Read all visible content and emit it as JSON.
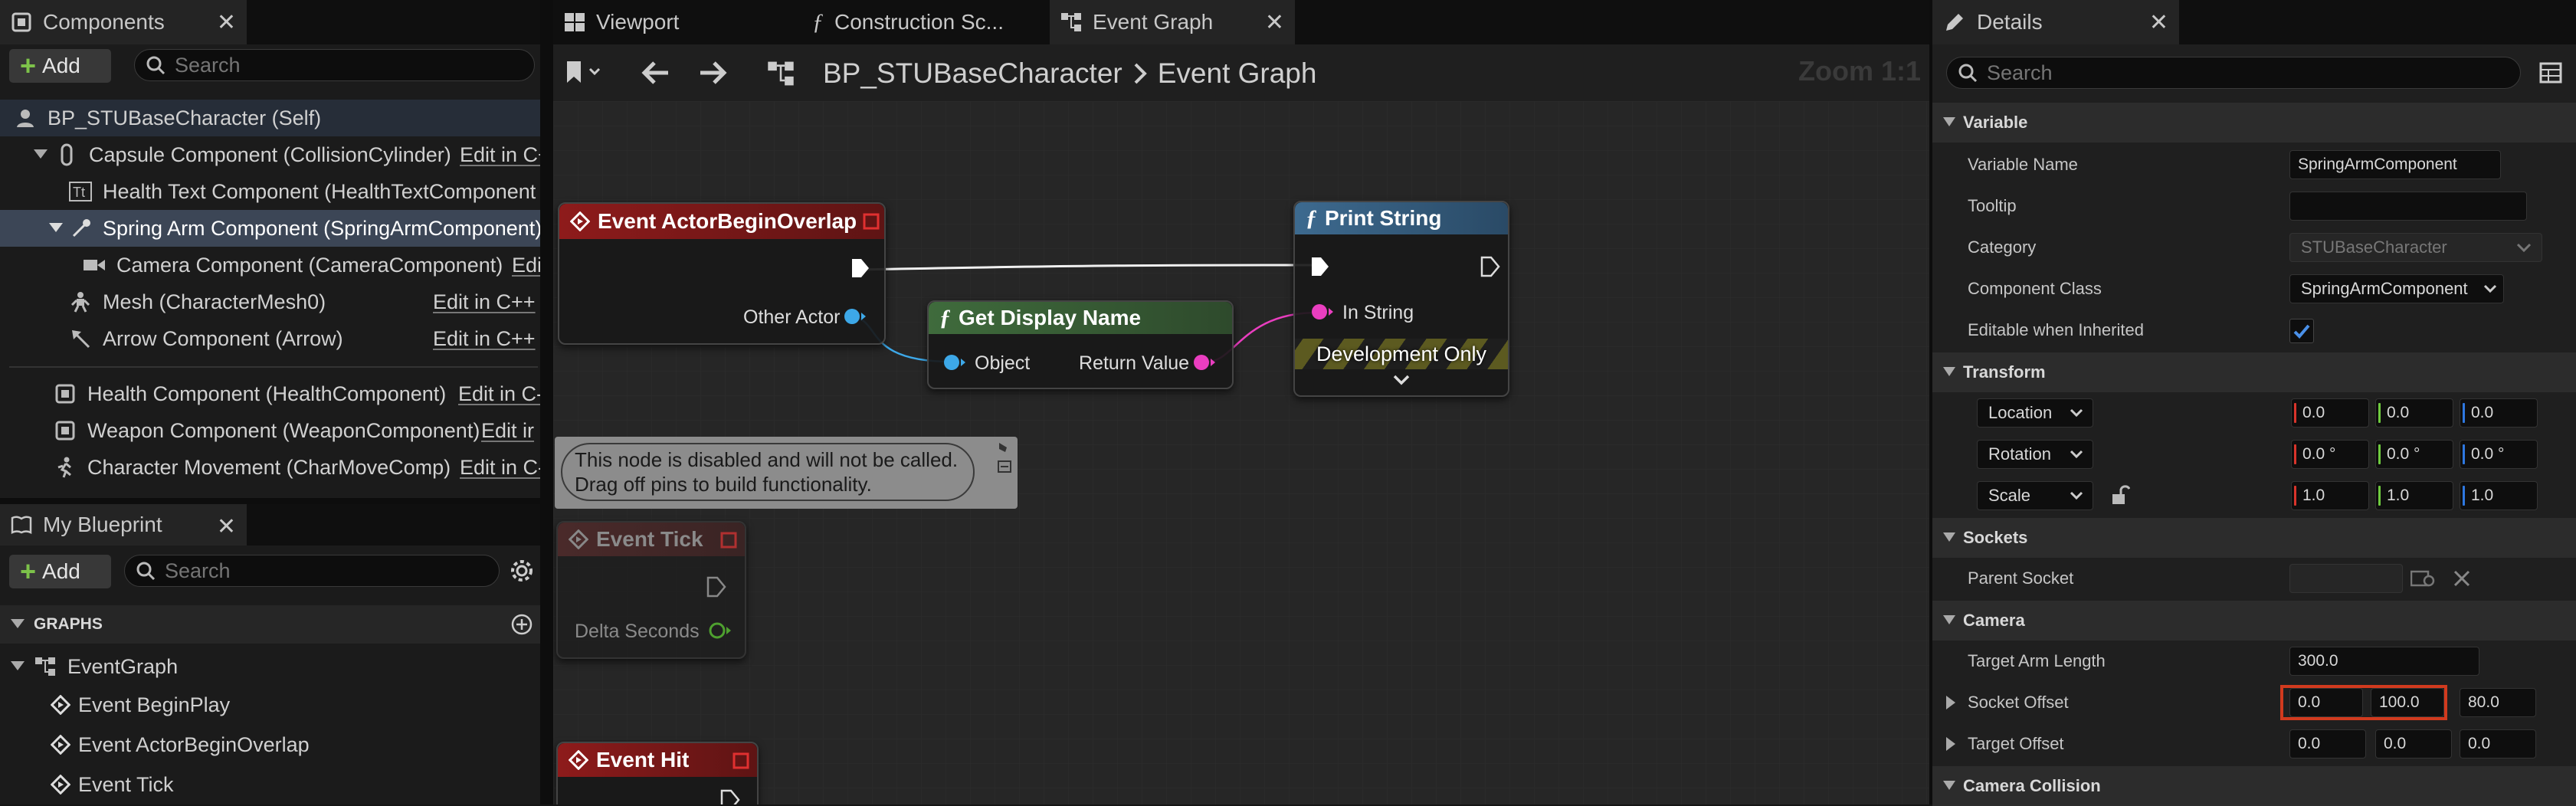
{
  "components": {
    "tab_label": "Components",
    "add_label": "Add",
    "search_placeholder": "Search",
    "tree": [
      {
        "label": "BP_STUBaseCharacter (Self)",
        "edit": ""
      },
      {
        "label": "Capsule Component (CollisionCylinder)",
        "edit": "Edit in C+"
      },
      {
        "label": "Health Text Component (HealthTextComponent",
        "edit": ""
      },
      {
        "label": "Spring Arm Component (SpringArmComponent)",
        "edit": ""
      },
      {
        "label": "Camera Component (CameraComponent)",
        "edit": "Edi"
      },
      {
        "label": "Mesh (CharacterMesh0)",
        "edit": "Edit in C++"
      },
      {
        "label": "Arrow Component (Arrow)",
        "edit": "Edit in C++"
      },
      {
        "label": "Health Component (HealthComponent)",
        "edit": "Edit in C-"
      },
      {
        "label": "Weapon Component (WeaponComponent)",
        "edit": "Edit ir"
      },
      {
        "label": "Character Movement (CharMoveComp)",
        "edit": "Edit in C-"
      }
    ]
  },
  "my_blueprint": {
    "tab_label": "My Blueprint",
    "add_label": "Add",
    "search_placeholder": "Search",
    "graphs_header": "GRAPHS",
    "items": [
      "EventGraph",
      "Event BeginPlay",
      "Event ActorBeginOverlap",
      "Event Tick"
    ]
  },
  "editor_tabs": [
    "Viewport",
    "Construction Sc...",
    "Event Graph"
  ],
  "breadcrumb": {
    "blueprint": "BP_STUBaseCharacter",
    "graph": "Event Graph"
  },
  "zoom_label": "Zoom 1:1",
  "nodes": {
    "overlap": {
      "title": "Event ActorBeginOverlap",
      "pin_other_actor": "Other Actor"
    },
    "display_name": {
      "title": "Get Display Name",
      "pin_object": "Object",
      "pin_return": "Return Value"
    },
    "print_string": {
      "title": "Print String",
      "pin_in_string": "In String",
      "banner": "Development Only"
    },
    "tooltip": {
      "line1": "This node is disabled and will not be called.",
      "line2": "Drag off pins to build functionality."
    },
    "tick": {
      "title": "Event Tick",
      "pin_delta": "Delta Seconds"
    },
    "hit": {
      "title": "Event Hit"
    }
  },
  "details": {
    "tab_label": "Details",
    "search_placeholder": "Search",
    "sections": {
      "variable": "Variable",
      "transform": "Transform",
      "sockets": "Sockets",
      "camera": "Camera",
      "camera_collision": "Camera Collision"
    },
    "variable_name_label": "Variable Name",
    "variable_name_value": "SpringArmComponent",
    "tooltip_label": "Tooltip",
    "tooltip_value": "",
    "category_label": "Category",
    "category_value": "STUBaseCharacter",
    "component_class_label": "Component Class",
    "component_class_value": "SpringArmComponent",
    "editable_inherited_label": "Editable when Inherited",
    "editable_inherited_checked": true,
    "location_label": "Location",
    "location_values": [
      "0.0",
      "0.0",
      "0.0"
    ],
    "rotation_label": "Rotation",
    "rotation_values": [
      "0.0 °",
      "0.0 °",
      "0.0 °"
    ],
    "scale_label": "Scale",
    "scale_values": [
      "1.0",
      "1.0",
      "1.0"
    ],
    "parent_socket_label": "Parent Socket",
    "target_arm_length_label": "Target Arm Length",
    "target_arm_length_value": "300.0",
    "socket_offset_label": "Socket Offset",
    "socket_offset_values": [
      "0.0",
      "100.0",
      "80.0"
    ],
    "target_offset_label": "Target Offset",
    "target_offset_values": [
      "0.0",
      "0.0",
      "0.0"
    ]
  },
  "colors": {
    "event_header": "#8e1b1b",
    "function_header_green": "#3f6b3c",
    "function_header_blue": "#3d6a8f",
    "selection": "#3c4656",
    "highlight_box": "#d13a1e",
    "pin_object": "#3da8e8",
    "pin_string": "#ea3ec0",
    "pin_float": "#6ecb3f"
  }
}
